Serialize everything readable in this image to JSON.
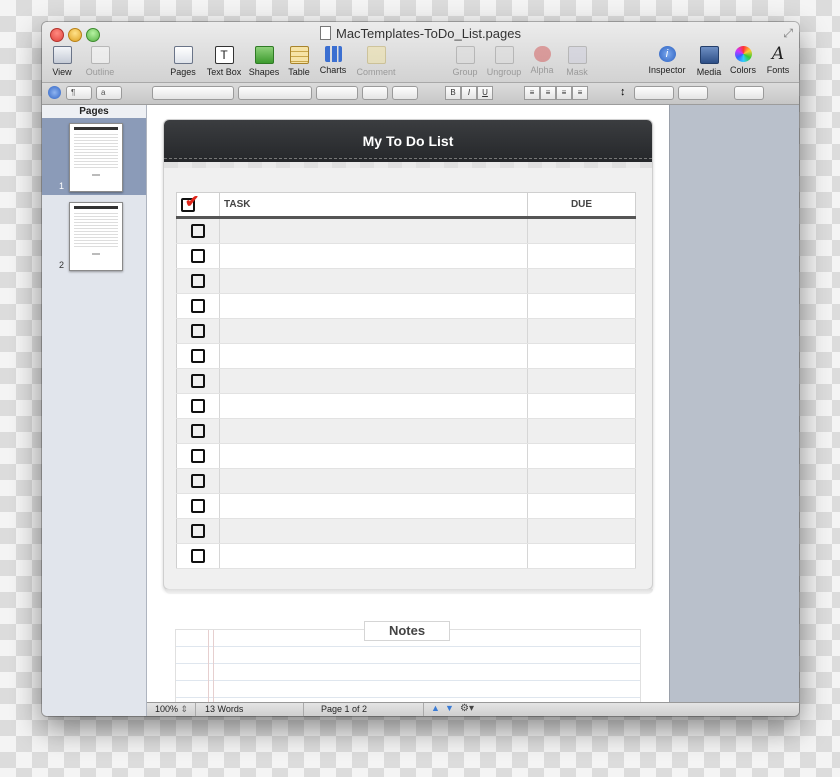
{
  "window": {
    "title": "MacTemplates-ToDo_List.pages"
  },
  "toolbar": {
    "items": [
      {
        "label": "View",
        "icon": "view-icon",
        "enabled": true
      },
      {
        "label": "Outline",
        "icon": "outline-icon",
        "enabled": false
      },
      {
        "label": "Pages",
        "icon": "pages-icon",
        "enabled": true
      },
      {
        "label": "Text Box",
        "icon": "text-box-icon",
        "enabled": true
      },
      {
        "label": "Shapes",
        "icon": "shapes-icon",
        "enabled": true
      },
      {
        "label": "Table",
        "icon": "table-icon",
        "enabled": true
      },
      {
        "label": "Charts",
        "icon": "charts-icon",
        "enabled": true
      },
      {
        "label": "Comment",
        "icon": "comment-icon",
        "enabled": false
      },
      {
        "label": "Group",
        "icon": "group-icon",
        "enabled": false
      },
      {
        "label": "Ungroup",
        "icon": "ungroup-icon",
        "enabled": false
      },
      {
        "label": "Alpha",
        "icon": "alpha-icon",
        "enabled": false
      },
      {
        "label": "Mask",
        "icon": "mask-icon",
        "enabled": false
      },
      {
        "label": "Inspector",
        "icon": "inspector-icon",
        "enabled": true
      },
      {
        "label": "Media",
        "icon": "media-icon",
        "enabled": true
      },
      {
        "label": "Colors",
        "icon": "colors-icon",
        "enabled": true
      },
      {
        "label": "Fonts",
        "icon": "fonts-icon",
        "enabled": true
      }
    ]
  },
  "formatbar": {
    "paragraph_glyph": "¶",
    "char_style_glyph": "a",
    "bold": "B",
    "italic": "I",
    "underline": "U"
  },
  "sidebar": {
    "header": "Pages",
    "pages": [
      {
        "number": "1",
        "selected": true
      },
      {
        "number": "2",
        "selected": false
      }
    ]
  },
  "document": {
    "card_title": "My To Do List",
    "columns": {
      "task": "TASK",
      "due": "DUE"
    },
    "row_count": 14,
    "notes_label": "Notes"
  },
  "status": {
    "zoom": "100%",
    "word_count": "13 Words",
    "page_indicator": "Page 1 of 2"
  },
  "colors": {
    "card_header": "#2c2e31",
    "checkmark": "#e0261b",
    "selection": "#8b9bb8"
  }
}
